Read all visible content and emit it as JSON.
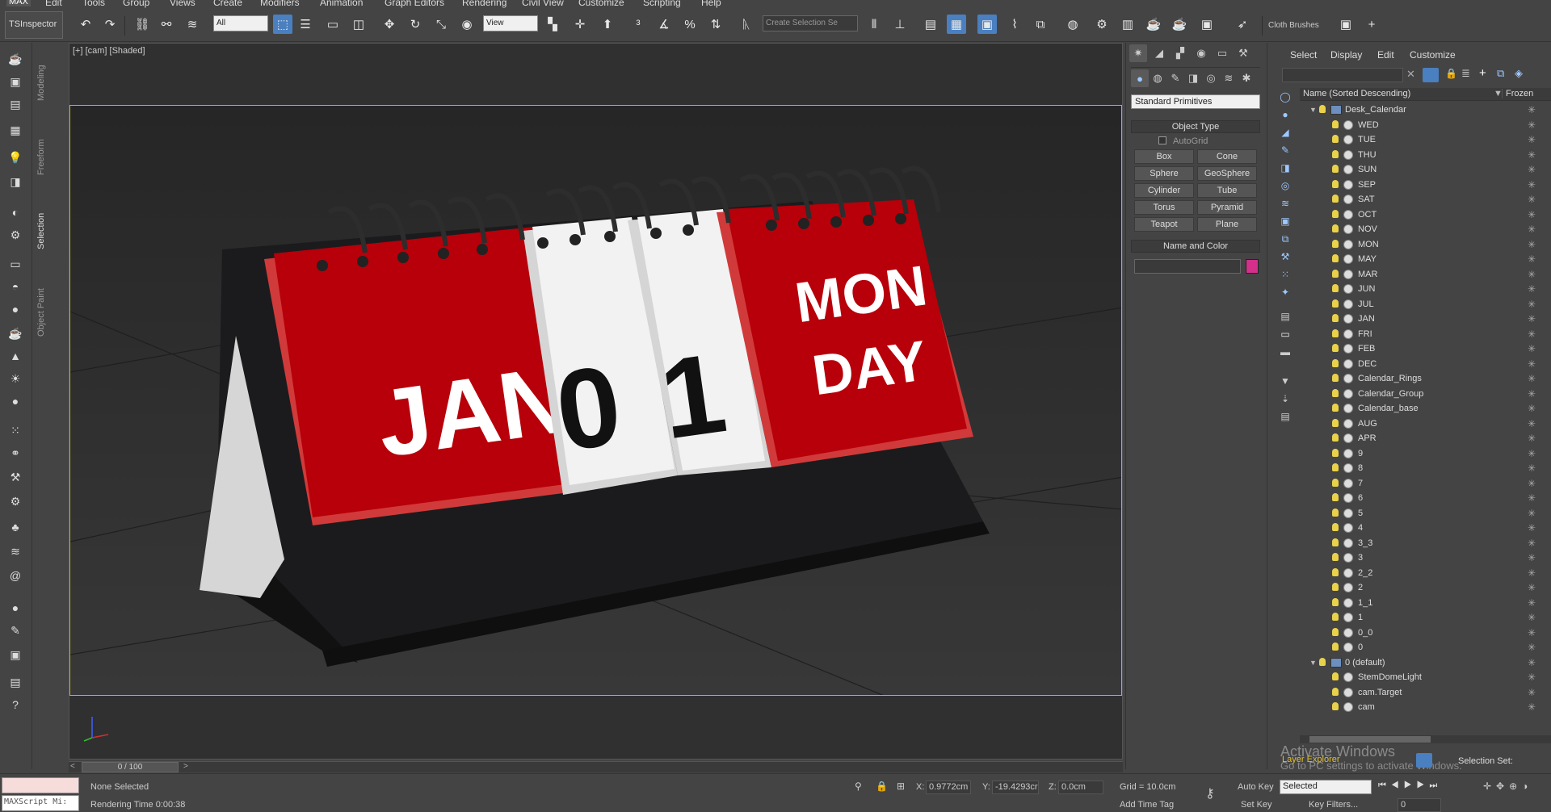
{
  "menu": [
    "MAX",
    "Edit",
    "Tools",
    "Group",
    "Views",
    "Create",
    "Modifiers",
    "Animation",
    "Graph Editors",
    "Rendering",
    "Civil View",
    "Customize",
    "Scripting",
    "Help"
  ],
  "toolbar": {
    "ts_inspector": "TSInspector",
    "selection_filter": "All",
    "ref_coord": "View",
    "selection_set_placeholder": "Create Selection Se",
    "cloth_brushes": "Cloth Brushes"
  },
  "ribbon_tabs": [
    "Modeling",
    "Freeform",
    "Selection",
    "Object Paint"
  ],
  "viewport": {
    "label": "[+] [cam] [Shaded]",
    "month": "JAN",
    "digit1": "0",
    "digit2": "1",
    "day1": "MON",
    "day2": "DAY",
    "colors": {
      "red": "#b7000a",
      "white": "#f2f2f2",
      "base": "#1b1b1d"
    }
  },
  "command_panel": {
    "category": "Standard Primitives",
    "object_type_header": "Object Type",
    "autogrid": "AutoGrid",
    "buttons": [
      "Box",
      "Cone",
      "Sphere",
      "GeoSphere",
      "Cylinder",
      "Tube",
      "Torus",
      "Pyramid",
      "Teapot",
      "Plane"
    ],
    "name_color_header": "Name and Color",
    "swatch_color": "#d2308a"
  },
  "layer_explorer": {
    "menu": [
      "Select",
      "Display",
      "Edit",
      "Customize"
    ],
    "col_name": "Name (Sorted Descending)",
    "col_frozen": "Frozen",
    "layer1": "Desk_Calendar",
    "items": [
      "WED",
      "TUE",
      "THU",
      "SUN",
      "SEP",
      "SAT",
      "OCT",
      "NOV",
      "MON",
      "MAY",
      "MAR",
      "JUN",
      "JUL",
      "JAN",
      "FRI",
      "FEB",
      "DEC",
      "Calendar_Rings",
      "Calendar_Group",
      "Calendar_base",
      "AUG",
      "APR",
      "9",
      "8",
      "7",
      "6",
      "5",
      "4",
      "3_3",
      "3",
      "2_2",
      "2",
      "1_1",
      "1",
      "0_0",
      "0"
    ],
    "layer2": "0 (default)",
    "items2": [
      "StemDomeLight",
      "cam.Target",
      "cam"
    ],
    "footer_label": "Layer Explorer",
    "selection_set_label": "Selection Set:",
    "watermark1": "Activate Windows",
    "watermark2": "Go to PC settings to activate Windows."
  },
  "timeline": {
    "frame": "0 / 100"
  },
  "status": {
    "maxscript": "MAXScript Mi:",
    "selected": "None Selected",
    "render_time": "Rendering Time  0:00:38",
    "x_label": "X:",
    "x": "0.9772cm",
    "y_label": "Y:",
    "y": "-19.4293cr",
    "z_label": "Z:",
    "z": "0.0cm",
    "grid": "Grid = 10.0cm",
    "add_time_tag": "Add Time Tag",
    "auto_key": "Auto Key",
    "set_key": "Set Key",
    "key_mode": "Selected",
    "key_filters": "Key Filters...",
    "frame_field": "0"
  }
}
